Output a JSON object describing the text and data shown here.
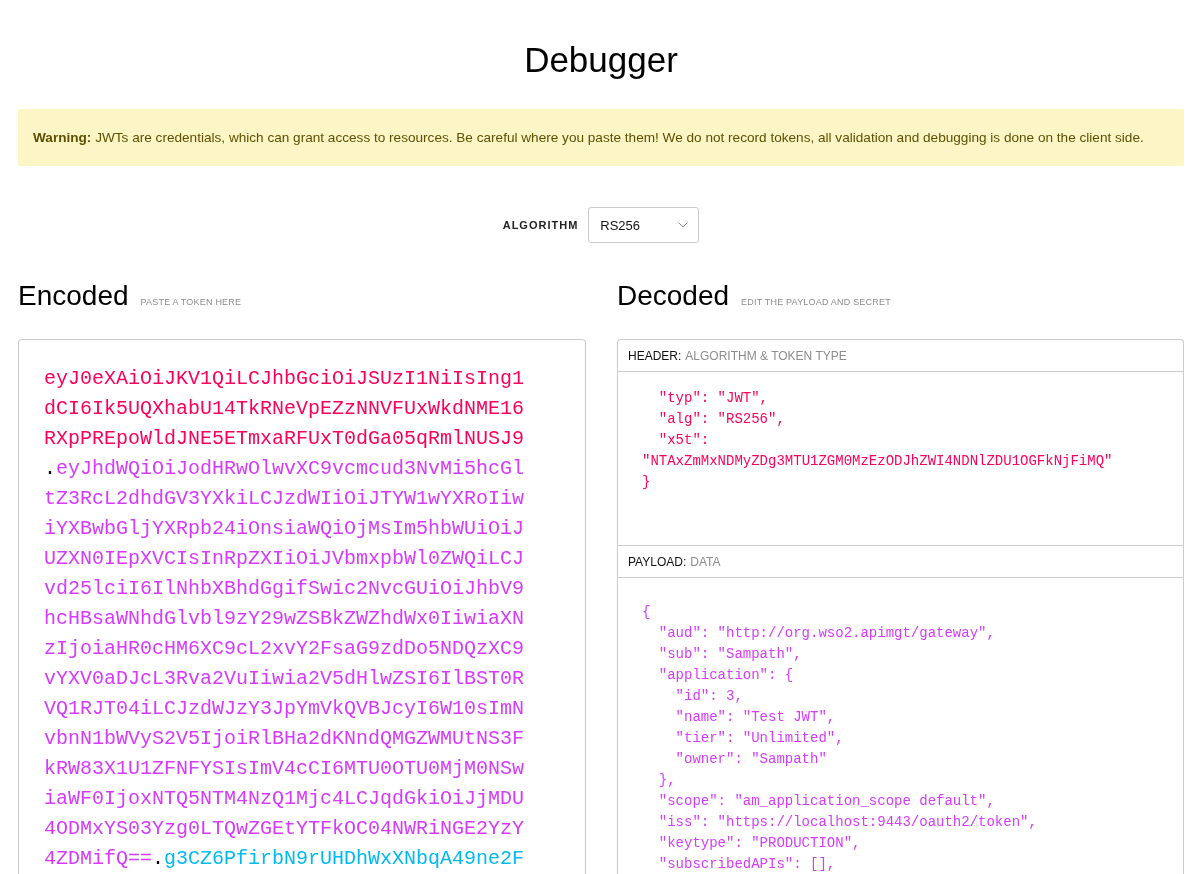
{
  "page_title": "Debugger",
  "warning": {
    "text": "**Warning:** JWTs are credentials, which can grant access to resources. Be careful where you paste them! We do not record tokens, all validation and debugging is done on the client side."
  },
  "algorithm": {
    "label": "ALGORITHM",
    "value": "RS256"
  },
  "encoded": {
    "title": "Encoded",
    "hint": "PASTE A TOKEN HERE",
    "token_parts": [
      {
        "kind": "header",
        "text": "eyJ0eXAiOiJKV1QiLCJhbGciOiJSUzI1NiIsIng1dCI6Ik5UQXhabU14TkRNeVpEZzNNVFUxWkdNME16RXpPREpoWldJNE5ETmxaRFUxT0dGa05qRmlNUSJ9"
      },
      {
        "kind": "separator",
        "text": "."
      },
      {
        "kind": "payload",
        "text": "eyJhdWQiOiJodHRwOlwvXC9vcmcud3NvMi5hcGltZ3RcL2dhdGV3YXkiLCJzdWIiOiJTYW1wYXRoIiwiYXBwbGljYXRpb24iOnsiaWQiOjMsIm5hbWUiOiJUZXN0IEpXVCIsInRpZXIiOiJVbmxpbWl0ZWQiLCJvd25lciI6IlNhbXBhdGgifSwic2NvcGUiOiJhbV9hcHBsaWNhdGlvbl9zY29wZSBkZWZhdWx0IiwiaXNzIjoiaHR0cHM6XC9cL2xvY2FsaG9zdDo5NDQzXC9vYXV0aDJcL3Rva2VuIiwia2V5dHlwZSI6IlBST0RVQ1RJT04iLCJzdWJzY3JpYmVkQVBJcyI6W10sImNvbnN1bWVyS2V5IjoiRlBHa2dKNndQMGZWMUtNS3FkRW83X1U1ZFNFYSIsImV4cCI6MTU0OTU0MjM0NSwiaWF0IjoxNTQ5NTM4NzQ1Mjc4LCJqdGkiOiJjMDU4ODMxYS03Yzg0LTQwZGEtYTFkOC04NWRiNGE2YzY4ZDMifQ=="
      },
      {
        "kind": "separator",
        "text": "."
      },
      {
        "kind": "signature",
        "text": "g3CZ6PfirbN9rUHDhWxXNbqA49ne2F"
      }
    ]
  },
  "decoded": {
    "title": "Decoded",
    "hint": "EDIT THE PAYLOAD AND SECRET",
    "sections": [
      {
        "kind": "header",
        "label": "HEADER:",
        "caption": "ALGORITHM & TOKEN TYPE",
        "code": {
          "entries": [
            {
              "text": "\"typ\": \"JWT\","
            },
            {
              "text": "\"alg\": \"RS256\","
            },
            {
              "text": "\"x5t\": \"NTAxZmMxNDMyZDg3MTU1ZGM0MzEzODJhZWI4NDNlZDU1OGFkNjFiMQ\""
            }
          ],
          "close": "}"
        }
      },
      {
        "kind": "payload",
        "label": "PAYLOAD:",
        "caption": "DATA",
        "code": {
          "open": "{",
          "entries": [
            {
              "text": "\"aud\": \"http://org.wso2.apimgt/gateway\","
            },
            {
              "text": "\"sub\": \"Sampath\","
            },
            {
              "text": "\"application\": {",
              "children": [
                {
                  "text": "\"id\": 3,"
                },
                {
                  "text": "\"name\": \"Test JWT\","
                },
                {
                  "text": "\"tier\": \"Unlimited\","
                },
                {
                  "text": "\"owner\": \"Sampath\""
                }
              ],
              "close": "},"
            },
            {
              "text": "\"scope\": \"am_application_scope default\","
            },
            {
              "text": "\"iss\": \"https://localhost:9443/oauth2/token\","
            },
            {
              "text": "\"keytype\": \"PRODUCTION\","
            },
            {
              "text": "\"subscribedAPIs\": [],"
            }
          ]
        }
      }
    ]
  }
}
